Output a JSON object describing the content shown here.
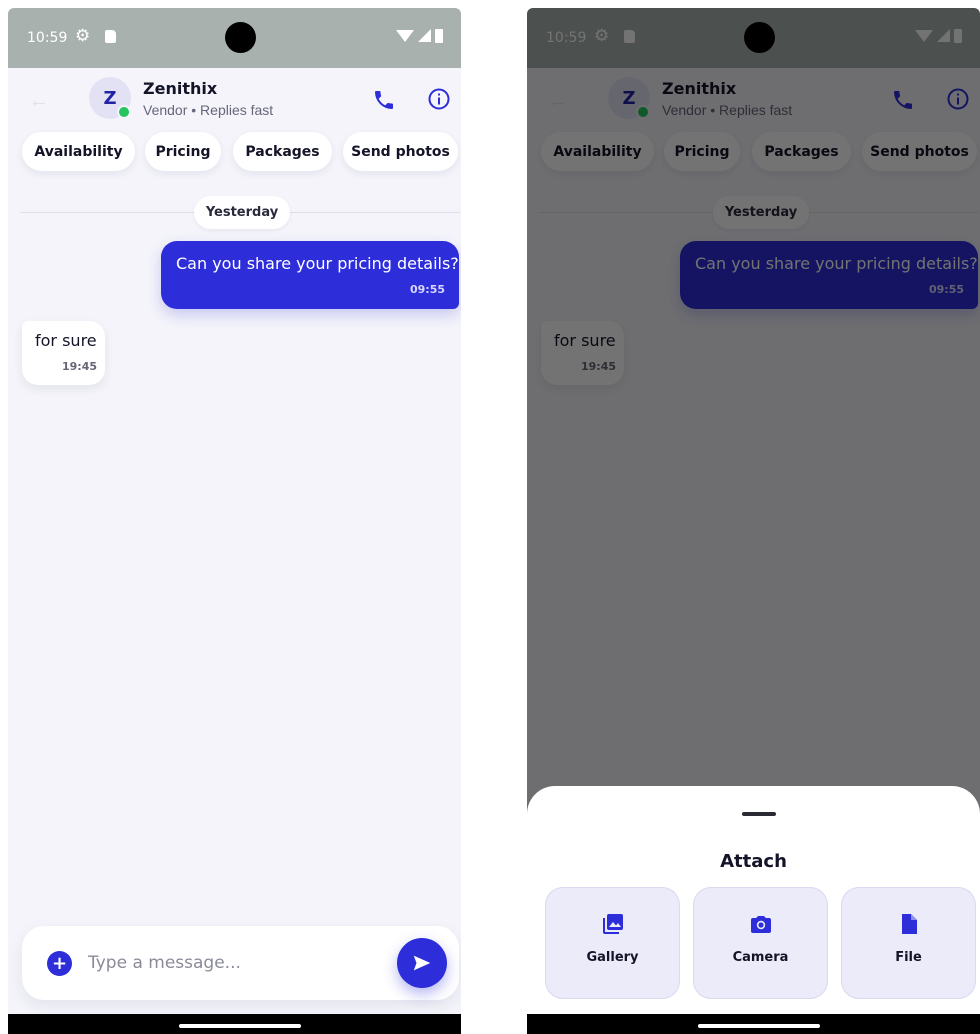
{
  "status_bar": {
    "time": "10:59"
  },
  "chat_header": {
    "avatar_initial": "Z",
    "vendor_name": "Zenithix",
    "vendor_status": "Vendor • Replies fast"
  },
  "quick_replies": [
    "Availability",
    "Pricing",
    "Packages",
    "Send photos"
  ],
  "date_separator": "Yesterday",
  "messages": [
    {
      "direction": "outgoing",
      "text": "Can you share your pricing details?",
      "time": "09:55"
    },
    {
      "direction": "incoming",
      "text": "for sure",
      "time": "19:45"
    }
  ],
  "composer": {
    "placeholder": "Type a message..."
  },
  "attach_sheet": {
    "title": "Attach",
    "options": [
      {
        "label": "Gallery",
        "icon": "gallery-icon"
      },
      {
        "label": "Camera",
        "icon": "camera-icon"
      },
      {
        "label": "File",
        "icon": "file-icon"
      }
    ]
  },
  "colors": {
    "accent": "#2d2dd9",
    "background": "#f4f4fa",
    "online": "#22c55e",
    "status_bar": "#a9b1ae"
  }
}
